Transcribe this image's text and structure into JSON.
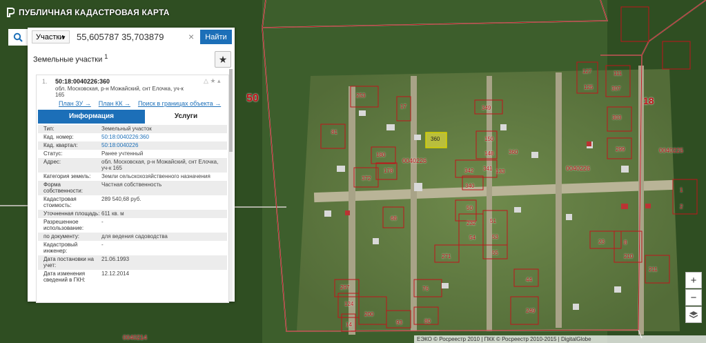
{
  "app": {
    "title": "ПУБЛИЧНАЯ КАДАСТРОВАЯ КАРТА"
  },
  "search": {
    "type": "Участки",
    "value": "55,605787 35,703879",
    "button": "Найти"
  },
  "section": {
    "title": "Земельные участки",
    "count": "1"
  },
  "result": {
    "index": "1.",
    "cad_number": "50:18:0040226:360",
    "address": "обл. Московская, р-н Можайский, снт Елочка, уч-к 165",
    "links": [
      "План ЗУ →",
      "План КК →",
      "Поиск в границах объекта →"
    ]
  },
  "tabs": {
    "info": "Информация",
    "services": "Услуги"
  },
  "rows": [
    {
      "k": "Тип:",
      "v": "Земельный участок"
    },
    {
      "k": "Кад. номер:",
      "v": "50:18:0040226:360",
      "link": true
    },
    {
      "k": "Кад. квартал:",
      "v": "50:18:0040226",
      "link": true
    },
    {
      "k": "Статус:",
      "v": "Ранее учтенный"
    },
    {
      "k": "Адрес:",
      "v": "обл. Московская, р-н Можайский, снт Елочка, уч-к 165"
    },
    {
      "k": "Категория земель:",
      "v": "Земли сельскохозяйственного назначения"
    },
    {
      "k": "Форма собственности:",
      "v": "Частная собственность"
    },
    {
      "k": "Кадастровая стоимость:",
      "v": "289 540,68 руб."
    },
    {
      "k": "Уточненная площадь:",
      "v": "611 кв. м"
    },
    {
      "k": "Разрешенное использование:",
      "v": "-"
    },
    {
      "k": "по документу:",
      "v": "для ведения садоводства"
    },
    {
      "k": "Кадастровый инженер:",
      "v": "-"
    },
    {
      "k": "Дата постановки на учет:",
      "v": "21.06.1993"
    },
    {
      "k": "Дата изменения сведений в ГКН:",
      "v": "12.12.2014"
    }
  ],
  "map": {
    "region_labels": [
      "50",
      "18"
    ],
    "quarter_labels": [
      "0040226",
      "0040226",
      "0040225",
      "0040214"
    ],
    "selected_parcel": "360",
    "parcels": [
      "127",
      "111",
      "125",
      "307",
      "253",
      "17",
      "349",
      "303",
      "81",
      "150",
      "299",
      "360",
      "148",
      "180",
      "178",
      "342",
      "341",
      "133",
      "372",
      "340",
      "1",
      "2",
      "50",
      "68",
      "232",
      "51",
      "54",
      "53",
      "23",
      "8",
      "271",
      "55",
      "210",
      "211",
      "44",
      "297",
      "76",
      "249",
      "124",
      "200",
      "93",
      "80",
      "14"
    ]
  },
  "attribution": "ЕЭКО © Росреестр 2010 | ПКК © Росреестр 2010-2015 | DigitalGlobe",
  "colors": {
    "accent": "#1c6fb8",
    "boundary": "#c0141b",
    "selected": "#e8e23a"
  }
}
